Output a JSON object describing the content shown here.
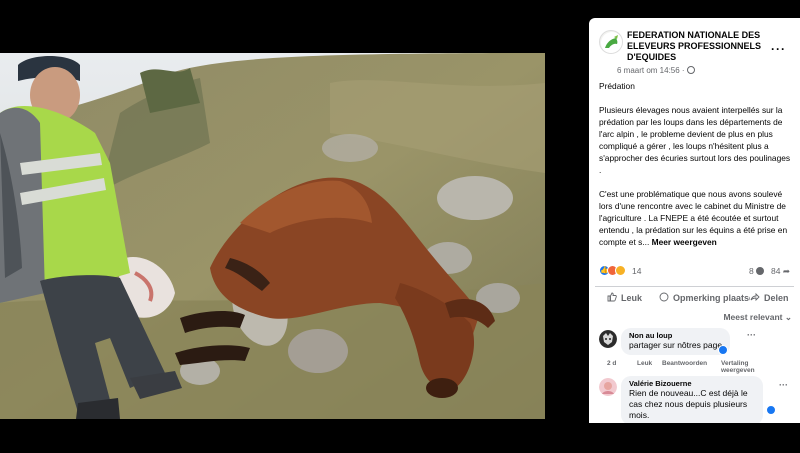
{
  "post": {
    "page_name": "FEDERATION NATIONALE DES ELEVEURS PROFESSIONNELS D'EQUIDES",
    "meta": "6 maart om 14:56 ·",
    "more_icon": "more-horizontal-icon",
    "paragraphs": [
      "Prédation",
      "Plusieurs élevages nous avaient interpellés sur la prédation par les loups dans les départements de l'arc alpin , le probleme devient de plus en plus compliqué a gérer , les loups n'hésitent plus a s'approcher des écuries surtout lors des poulinages .",
      "C'est une problématique que nous avons soulevé lors d'une rencontre avec le cabinet du Ministre de l'agriculture . La FNEPE a été écoutée et surtout entendu , la prédation sur les équins a été prise en compte et s..."
    ],
    "see_more": "Meer weergeven"
  },
  "stats": {
    "reaction_count": "14",
    "comment_count": "8",
    "share_count": "84"
  },
  "actions": {
    "like": "Leuk",
    "comment": "Opmerking plaatsen",
    "share": "Delen"
  },
  "comments_sort": "Meest relevant ⌄",
  "comments": [
    {
      "name": "Non au loup",
      "text": "partager sur nôtres page",
      "time": "2 d",
      "like": "Leuk",
      "reply": "Beantwoorden",
      "translate": "Vertaling weergeven"
    },
    {
      "name": "Valérie Bizouerne",
      "text": "Rien de nouveau...C est déjà le cas chez nous depuis plusieurs mois."
    }
  ],
  "colors": {
    "accent": "#1877f2",
    "background": "#000000",
    "panel": "#ffffff",
    "secondary_text": "#65676b"
  }
}
